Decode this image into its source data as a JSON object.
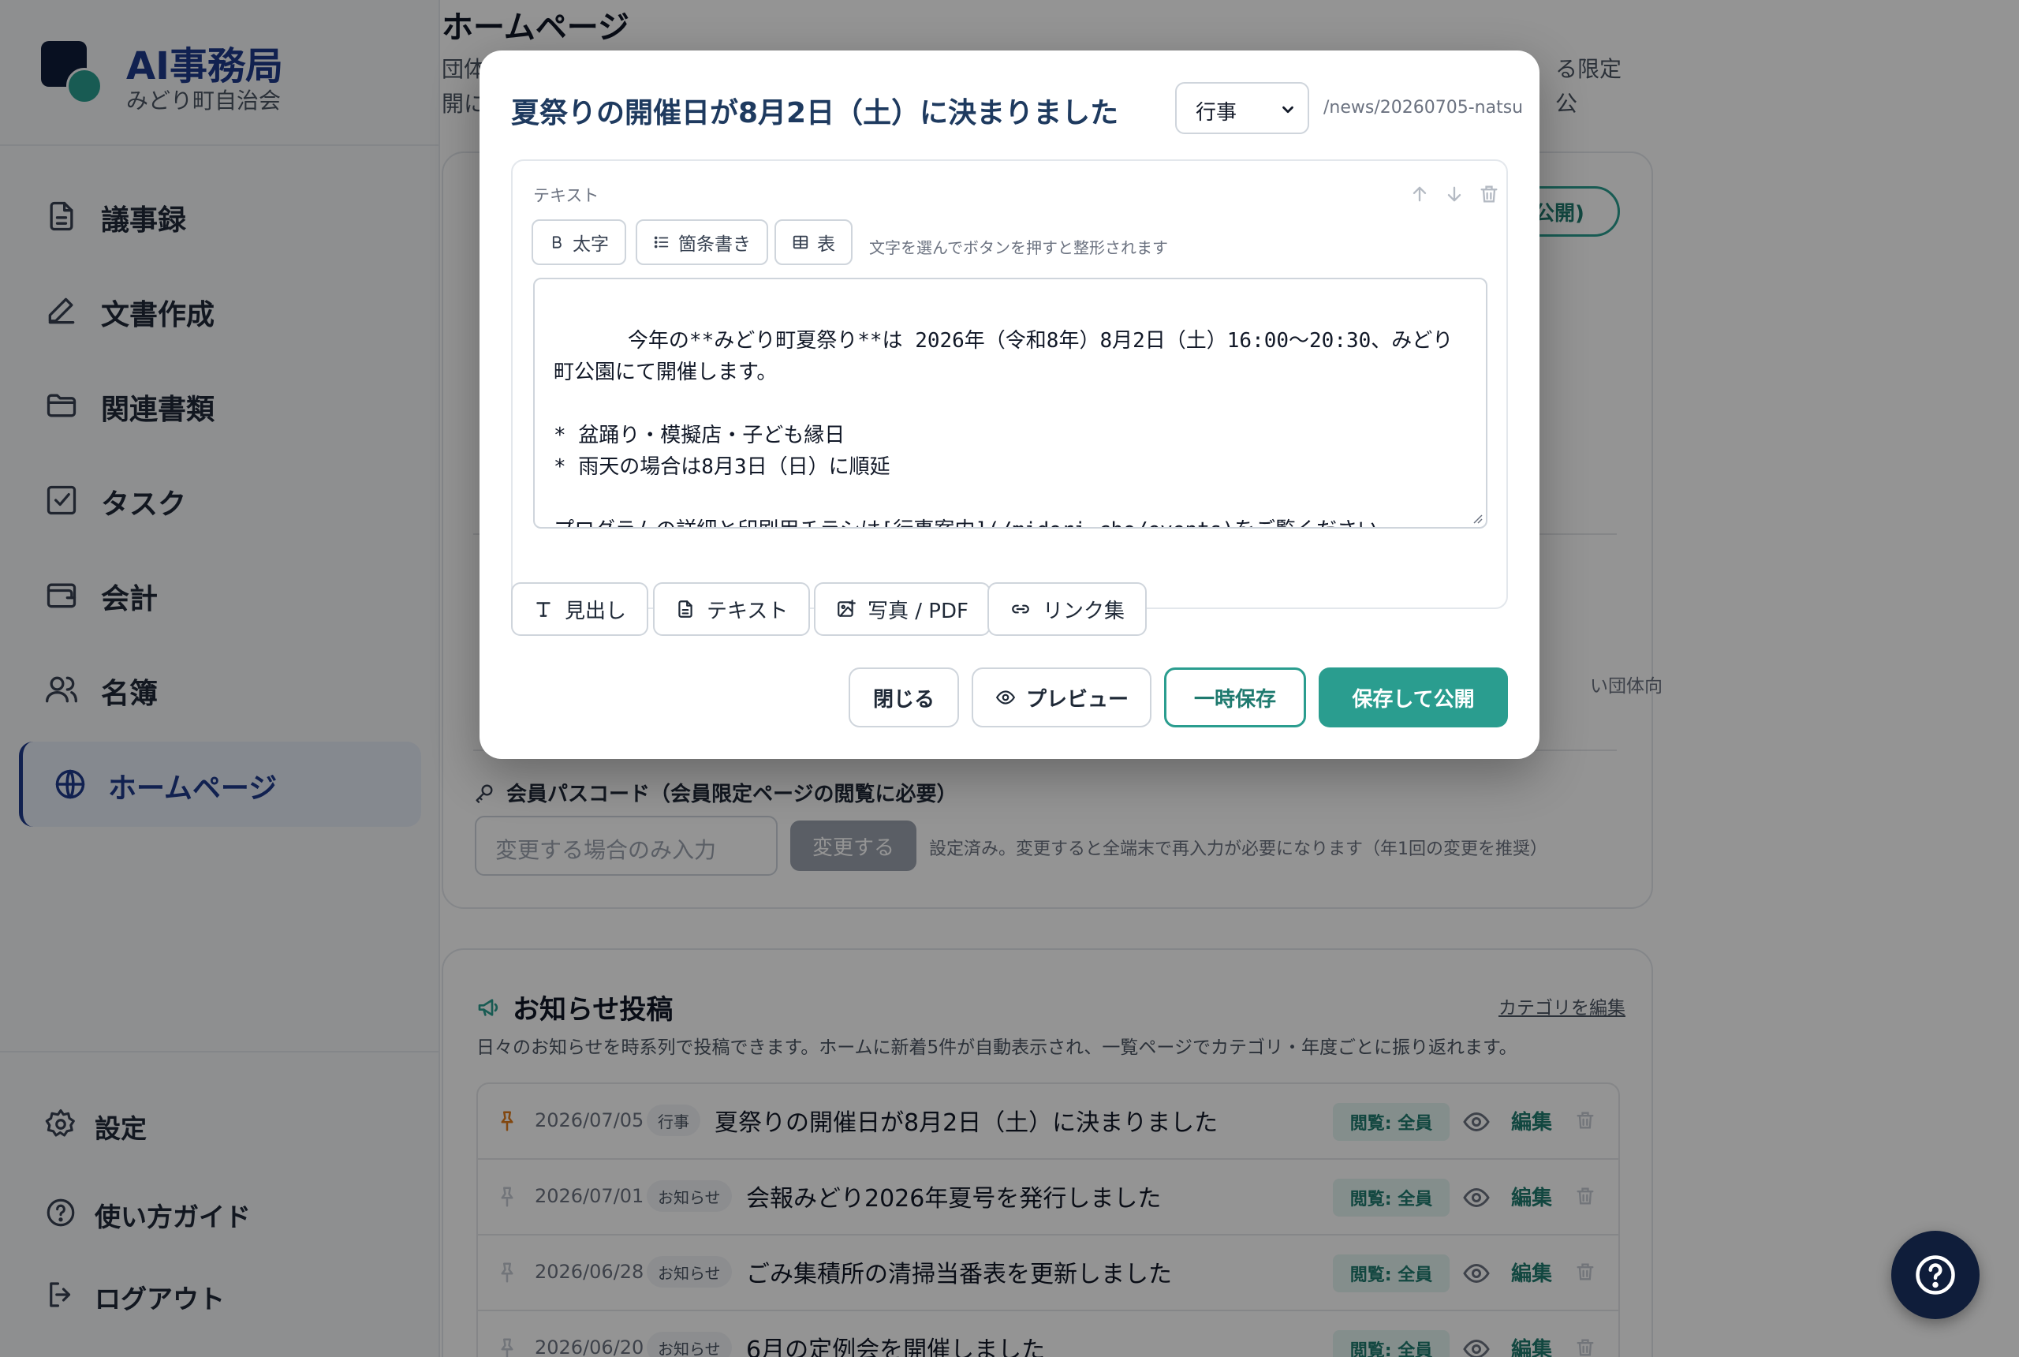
{
  "brand": {
    "title": "AI事務局",
    "subtitle": "みどり町自治会"
  },
  "sidebar": {
    "items": [
      {
        "label": "議事録",
        "icon": "document-icon"
      },
      {
        "label": "文書作成",
        "icon": "pencil-icon"
      },
      {
        "label": "関連書類",
        "icon": "folder-icon"
      },
      {
        "label": "タスク",
        "icon": "checkbox-icon"
      },
      {
        "label": "会計",
        "icon": "wallet-icon"
      },
      {
        "label": "名簿",
        "icon": "users-icon"
      },
      {
        "label": "ホームページ",
        "icon": "globe-icon",
        "active": true
      }
    ],
    "footer": [
      {
        "label": "設定",
        "icon": "gear-icon"
      },
      {
        "label": "使い方ガイド",
        "icon": "help-circle-icon"
      },
      {
        "label": "ログアウト",
        "icon": "logout-icon"
      }
    ]
  },
  "page": {
    "title": "ホームページ",
    "desc_line1": "団体",
    "desc_line1_end": "る限定公",
    "desc_line2": "開に"
  },
  "settings": {
    "publish_pill": "公開)",
    "right_note": "い団体向",
    "passcode": {
      "label": "会員パスコード（会員限定ページの閲覧に必要）",
      "placeholder": "変更する場合のみ入力",
      "button": "変更する",
      "note": "設定済み。変更すると全端末で再入力が必要になります（年1回の変更を推奨）"
    }
  },
  "news": {
    "title": "お知らせ投稿",
    "category_edit": "カテゴリを編集",
    "desc": "日々のお知らせを時系列で投稿できます。ホームに新着5件が自動表示され、一覧ページでカテゴリ・年度ごとに振り返れます。",
    "rows": [
      {
        "date": "2026/07/05",
        "category": "行事",
        "title": "夏祭りの開催日が8月2日（土）に決まりました",
        "visibility": "閲覧: 全員",
        "edit": "編集",
        "pinned": true
      },
      {
        "date": "2026/07/01",
        "category": "お知らせ",
        "title": "会報みどり2026年夏号を発行しました",
        "visibility": "閲覧: 全員",
        "edit": "編集",
        "pinned": false
      },
      {
        "date": "2026/06/28",
        "category": "お知らせ",
        "title": "ごみ集積所の清掃当番表を更新しました",
        "visibility": "閲覧: 全員",
        "edit": "編集",
        "pinned": false
      },
      {
        "date": "2026/06/20",
        "category": "お知らせ",
        "title": "6月の定例会を開催しました",
        "visibility": "閲覧: 全員",
        "edit": "編集",
        "pinned": false
      }
    ]
  },
  "modal": {
    "title": "夏祭りの開催日が8月2日（土）に決まりました",
    "category": "行事",
    "slug": "/news/20260705-natsu",
    "block": {
      "label": "テキスト",
      "format_buttons": {
        "bold": "太字",
        "list": "箇条書き",
        "table": "表"
      },
      "hint": "文字を選んでボタンを押すと整形されます",
      "content": "今年の**みどり町夏祭り**は 2026年（令和8年）8月2日（土）16:00〜20:30、みどり町公園にて開催します。\n\n* 盆踊り・模擬店・子ども縁日\n* 雨天の場合は8月3日（日）に順延\n\nプログラムの詳細と印刷用チラシは[行事案内](/midori-cho/events)をご覧ください。\n模擬店・会場設営のお手伝いにご協力いただける方は、各丁目の班長までお知らせください。"
    },
    "add_buttons": {
      "heading": "見出し",
      "text": "テキスト",
      "media": "写真 / PDF",
      "links": "リンク集"
    },
    "actions": {
      "close": "閉じる",
      "preview": "プレビュー",
      "draft": "一時保存",
      "publish": "保存して公開"
    }
  },
  "colors": {
    "brand": "#1e3a8a",
    "accent": "#2a9d8f",
    "sidebar_bg": "#f4f6f9"
  }
}
